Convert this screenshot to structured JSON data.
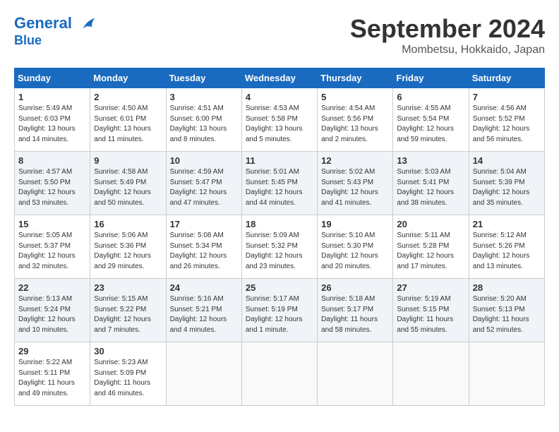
{
  "header": {
    "logo_line1": "General",
    "logo_line2": "Blue",
    "month": "September 2024",
    "location": "Mombetsu, Hokkaido, Japan"
  },
  "weekdays": [
    "Sunday",
    "Monday",
    "Tuesday",
    "Wednesday",
    "Thursday",
    "Friday",
    "Saturday"
  ],
  "weeks": [
    [
      {
        "day": "1",
        "rise": "5:49 AM",
        "set": "6:03 PM",
        "daylight": "13 hours and 14 minutes."
      },
      {
        "day": "2",
        "rise": "4:50 AM",
        "set": "6:01 PM",
        "daylight": "13 hours and 11 minutes."
      },
      {
        "day": "3",
        "rise": "4:51 AM",
        "set": "6:00 PM",
        "daylight": "13 hours and 8 minutes."
      },
      {
        "day": "4",
        "rise": "4:53 AM",
        "set": "5:58 PM",
        "daylight": "13 hours and 5 minutes."
      },
      {
        "day": "5",
        "rise": "4:54 AM",
        "set": "5:56 PM",
        "daylight": "13 hours and 2 minutes."
      },
      {
        "day": "6",
        "rise": "4:55 AM",
        "set": "5:54 PM",
        "daylight": "12 hours and 59 minutes."
      },
      {
        "day": "7",
        "rise": "4:56 AM",
        "set": "5:52 PM",
        "daylight": "12 hours and 56 minutes."
      }
    ],
    [
      {
        "day": "8",
        "rise": "4:57 AM",
        "set": "5:50 PM",
        "daylight": "12 hours and 53 minutes."
      },
      {
        "day": "9",
        "rise": "4:58 AM",
        "set": "5:49 PM",
        "daylight": "12 hours and 50 minutes."
      },
      {
        "day": "10",
        "rise": "4:59 AM",
        "set": "5:47 PM",
        "daylight": "12 hours and 47 minutes."
      },
      {
        "day": "11",
        "rise": "5:01 AM",
        "set": "5:45 PM",
        "daylight": "12 hours and 44 minutes."
      },
      {
        "day": "12",
        "rise": "5:02 AM",
        "set": "5:43 PM",
        "daylight": "12 hours and 41 minutes."
      },
      {
        "day": "13",
        "rise": "5:03 AM",
        "set": "5:41 PM",
        "daylight": "12 hours and 38 minutes."
      },
      {
        "day": "14",
        "rise": "5:04 AM",
        "set": "5:39 PM",
        "daylight": "12 hours and 35 minutes."
      }
    ],
    [
      {
        "day": "15",
        "rise": "5:05 AM",
        "set": "5:37 PM",
        "daylight": "12 hours and 32 minutes."
      },
      {
        "day": "16",
        "rise": "5:06 AM",
        "set": "5:36 PM",
        "daylight": "12 hours and 29 minutes."
      },
      {
        "day": "17",
        "rise": "5:08 AM",
        "set": "5:34 PM",
        "daylight": "12 hours and 26 minutes."
      },
      {
        "day": "18",
        "rise": "5:09 AM",
        "set": "5:32 PM",
        "daylight": "12 hours and 23 minutes."
      },
      {
        "day": "19",
        "rise": "5:10 AM",
        "set": "5:30 PM",
        "daylight": "12 hours and 20 minutes."
      },
      {
        "day": "20",
        "rise": "5:11 AM",
        "set": "5:28 PM",
        "daylight": "12 hours and 17 minutes."
      },
      {
        "day": "21",
        "rise": "5:12 AM",
        "set": "5:26 PM",
        "daylight": "12 hours and 13 minutes."
      }
    ],
    [
      {
        "day": "22",
        "rise": "5:13 AM",
        "set": "5:24 PM",
        "daylight": "12 hours and 10 minutes."
      },
      {
        "day": "23",
        "rise": "5:15 AM",
        "set": "5:22 PM",
        "daylight": "12 hours and 7 minutes."
      },
      {
        "day": "24",
        "rise": "5:16 AM",
        "set": "5:21 PM",
        "daylight": "12 hours and 4 minutes."
      },
      {
        "day": "25",
        "rise": "5:17 AM",
        "set": "5:19 PM",
        "daylight": "12 hours and 1 minute."
      },
      {
        "day": "26",
        "rise": "5:18 AM",
        "set": "5:17 PM",
        "daylight": "11 hours and 58 minutes."
      },
      {
        "day": "27",
        "rise": "5:19 AM",
        "set": "5:15 PM",
        "daylight": "11 hours and 55 minutes."
      },
      {
        "day": "28",
        "rise": "5:20 AM",
        "set": "5:13 PM",
        "daylight": "11 hours and 52 minutes."
      }
    ],
    [
      {
        "day": "29",
        "rise": "5:22 AM",
        "set": "5:11 PM",
        "daylight": "11 hours and 49 minutes."
      },
      {
        "day": "30",
        "rise": "5:23 AM",
        "set": "5:09 PM",
        "daylight": "11 hours and 46 minutes."
      },
      null,
      null,
      null,
      null,
      null
    ]
  ]
}
